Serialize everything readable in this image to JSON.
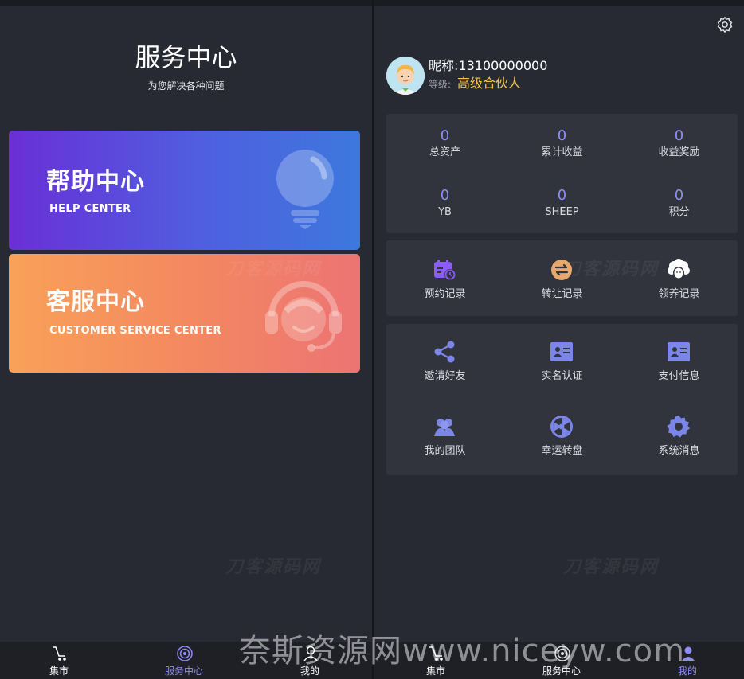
{
  "left": {
    "title": "服务中心",
    "subtitle": "为您解决各种问题",
    "help_card": {
      "title": "帮助中心",
      "subtitle": "HELP CENTER"
    },
    "cs_card": {
      "title": "客服中心",
      "subtitle": "CUSTOMER SERVICE CENTER"
    },
    "watermark": "刀客源码网"
  },
  "right": {
    "nickname": "昵称:13100000000",
    "level_label": "等级:",
    "level_value": "高级合伙人",
    "stats": [
      {
        "value": "0",
        "label": "总资产"
      },
      {
        "value": "0",
        "label": "累计收益"
      },
      {
        "value": "0",
        "label": "收益奖励"
      },
      {
        "value": "0",
        "label": "YB"
      },
      {
        "value": "0",
        "label": "SHEEP"
      },
      {
        "value": "0",
        "label": "积分"
      }
    ],
    "records": [
      {
        "label": "预约记录",
        "icon": "calendar-clock-icon"
      },
      {
        "label": "转让记录",
        "icon": "transfer-icon"
      },
      {
        "label": "领养记录",
        "icon": "sheep-icon"
      }
    ],
    "tools": [
      {
        "label": "邀请好友",
        "icon": "share-icon"
      },
      {
        "label": "实名认证",
        "icon": "id-card-icon"
      },
      {
        "label": "支付信息",
        "icon": "payment-card-icon"
      },
      {
        "label": "我的团队",
        "icon": "team-icon"
      },
      {
        "label": "幸运转盘",
        "icon": "wheel-icon"
      },
      {
        "label": "系统消息",
        "icon": "gear-icon"
      }
    ],
    "watermark": "刀客源码网"
  },
  "tabbar": {
    "market": "集市",
    "service": "服务中心",
    "mine": "我的"
  },
  "overlay_text": "奈斯资源网www.niceyw.com",
  "colors": {
    "background": "#282a33",
    "card_bg": "#31333d",
    "accent": "#8e8cf5",
    "gold": "#f3c54e"
  }
}
